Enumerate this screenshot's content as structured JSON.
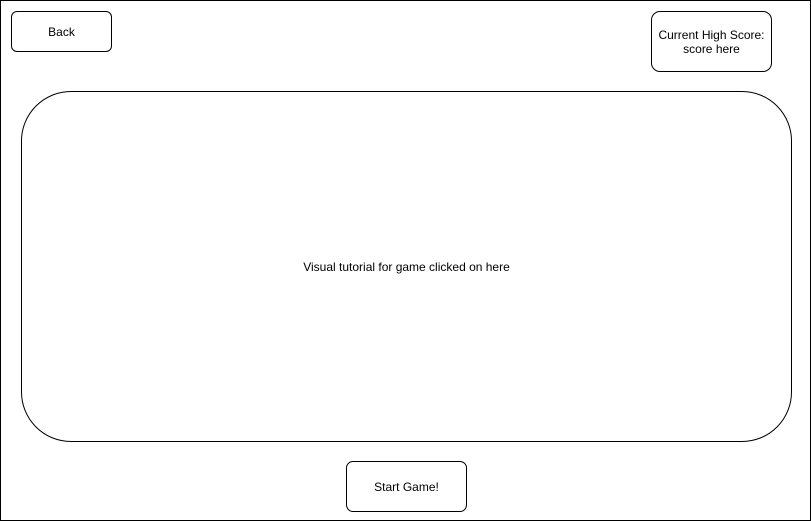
{
  "header": {
    "back_label": "Back",
    "high_score": {
      "label": "Current High Score:",
      "value": "score here"
    }
  },
  "main": {
    "tutorial_text": "Visual tutorial for game clicked on here"
  },
  "footer": {
    "start_label": "Start Game!"
  }
}
